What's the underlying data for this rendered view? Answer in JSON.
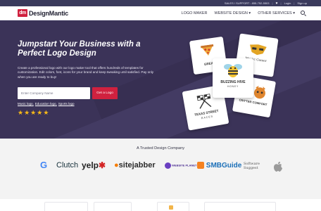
{
  "topbar": {
    "support": "SALES / SUPPORT : 855-752-5503",
    "login": "Login",
    "signup": "Sign up"
  },
  "header": {
    "logo_mark": "dm",
    "logo_text": "DesignMantic",
    "nav": [
      "LOGO MAKER",
      "WEBSITE DESIGN ▾",
      "OTHER SERVICES ▾"
    ]
  },
  "hero": {
    "title": "Jumpstart Your Business with a Perfect Logo Design",
    "description": "Create a professional logo with our logo maker tool that offers hundreds of templates for customization. Edit colors, font, icons for your brand and keep tweaking until satisfied. Pay only when you are ready to buy!",
    "input_placeholder": "Enter Company Name",
    "button_label": "Get a Logo",
    "links": [
      "Music logo,",
      "Education logo,",
      "Sports logo"
    ],
    "star_rating": 5
  },
  "logo_cards": {
    "card1": "GREAT",
    "card2": "Mystic Gamer",
    "card3_line1": "BUZZING HIVE",
    "card3_line2": "HONEY",
    "card4_line1": "TEXAS STREET",
    "card4_line2": "RACES",
    "card5": "CRITTER COMFORT"
  },
  "trusted": {
    "title": "A Trusted Design Company",
    "brands": [
      "G",
      "Clutch",
      "yelp",
      "sitejabber",
      "WEBSITE PLANET",
      "SMBGuide",
      "Software Suggest",
      ""
    ]
  },
  "colors": {
    "brand_red": "#d0213f",
    "hero_bg": "#3b3358",
    "star": "#f6b818"
  }
}
